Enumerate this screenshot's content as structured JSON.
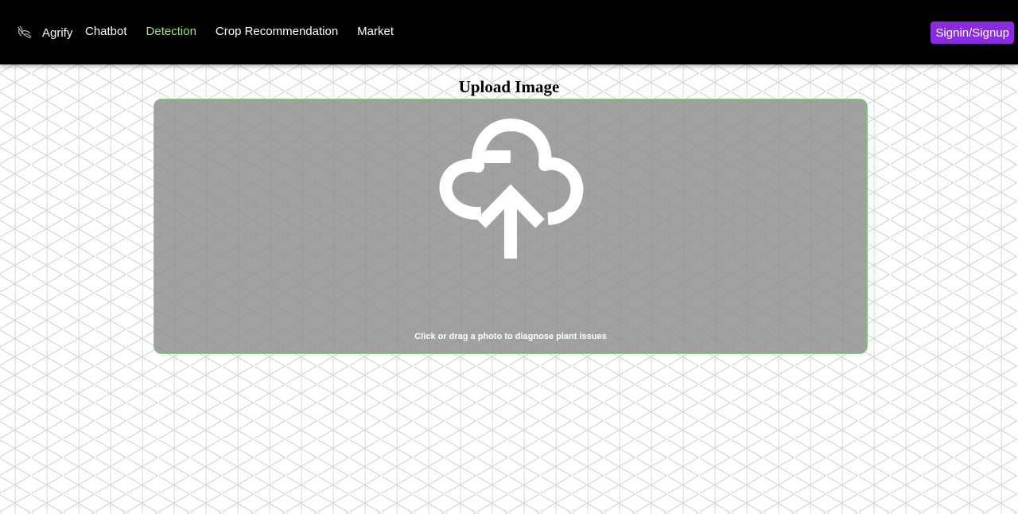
{
  "navbar": {
    "brand": "Agrify",
    "logo_icon": "leaf-logo-icon",
    "links": [
      {
        "label": "Chatbot",
        "active": false
      },
      {
        "label": "Detection",
        "active": true
      },
      {
        "label": "Crop Recommendation",
        "active": false
      },
      {
        "label": "Market",
        "active": false
      }
    ],
    "signin_label": "Signin/Signup",
    "active_color": "#9be37a",
    "button_color": "#8a2be2"
  },
  "upload": {
    "title": "Upload Image",
    "icon": "cloud-upload-icon",
    "hint": "Click or drag a photo to diagnose plant issues",
    "border_color": "#7ad37a"
  }
}
